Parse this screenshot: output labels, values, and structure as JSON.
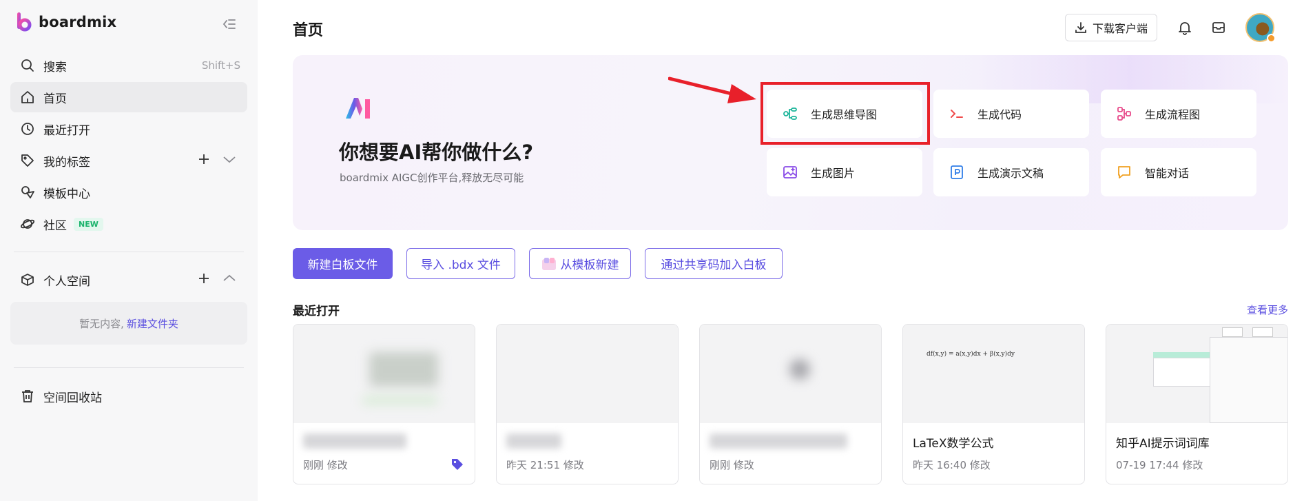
{
  "app": {
    "name": "boardmix"
  },
  "sidebar": {
    "search": {
      "label": "搜索",
      "shortcut": "Shift+S"
    },
    "items": [
      {
        "label": "首页",
        "icon": "home-icon"
      },
      {
        "label": "最近打开",
        "icon": "clock-icon"
      },
      {
        "label": "我的标签",
        "icon": "tag-icon"
      },
      {
        "label": "模板中心",
        "icon": "template-icon"
      },
      {
        "label": "社区",
        "icon": "planet-icon",
        "badge": "NEW"
      }
    ],
    "personal_space": {
      "label": "个人空间",
      "empty_text": "暂无内容,",
      "empty_link": "新建文件夹"
    },
    "trash": {
      "label": "空间回收站"
    }
  },
  "header": {
    "title": "首页",
    "download_label": "下载客户端"
  },
  "hero": {
    "title": "你想要AI帮你做什么?",
    "subtitle": "boardmix AIGC创作平台,释放无尽可能",
    "cards": [
      {
        "label": "生成思维导图",
        "icon": "mindmap-icon",
        "color": "#1cb59a"
      },
      {
        "label": "生成代码",
        "icon": "code-icon",
        "color": "#f04a4a"
      },
      {
        "label": "生成流程图",
        "icon": "flowchart-icon",
        "color": "#e84a8a"
      },
      {
        "label": "生成图片",
        "icon": "image-icon",
        "color": "#8a4de8"
      },
      {
        "label": "生成演示文稿",
        "icon": "presentation-icon",
        "color": "#2f7de8"
      },
      {
        "label": "智能对话",
        "icon": "chat-icon",
        "color": "#f0a020"
      }
    ]
  },
  "actions": {
    "new_board": "新建白板文件",
    "import_bdx": "导入 .bdx 文件",
    "from_template": "从模板新建",
    "join_by_code": "通过共享码加入白板"
  },
  "recent": {
    "title": "最近打开",
    "see_more": "查看更多",
    "files": [
      {
        "name": "",
        "time": "刚刚 修改"
      },
      {
        "name": "",
        "time": "昨天 21:51 修改"
      },
      {
        "name": "",
        "time": "刚刚 修改"
      },
      {
        "name": "LaTeX数学公式",
        "time": "昨天 16:40 修改",
        "thumb_text": "df(x,y) = a(x,y)dx + β(x,y)dy"
      },
      {
        "name": "知乎AI提示词词库",
        "time": "07-19 17:44 修改"
      }
    ]
  },
  "colors": {
    "accent": "#6b5ce7",
    "highlight": "#e8202a"
  }
}
